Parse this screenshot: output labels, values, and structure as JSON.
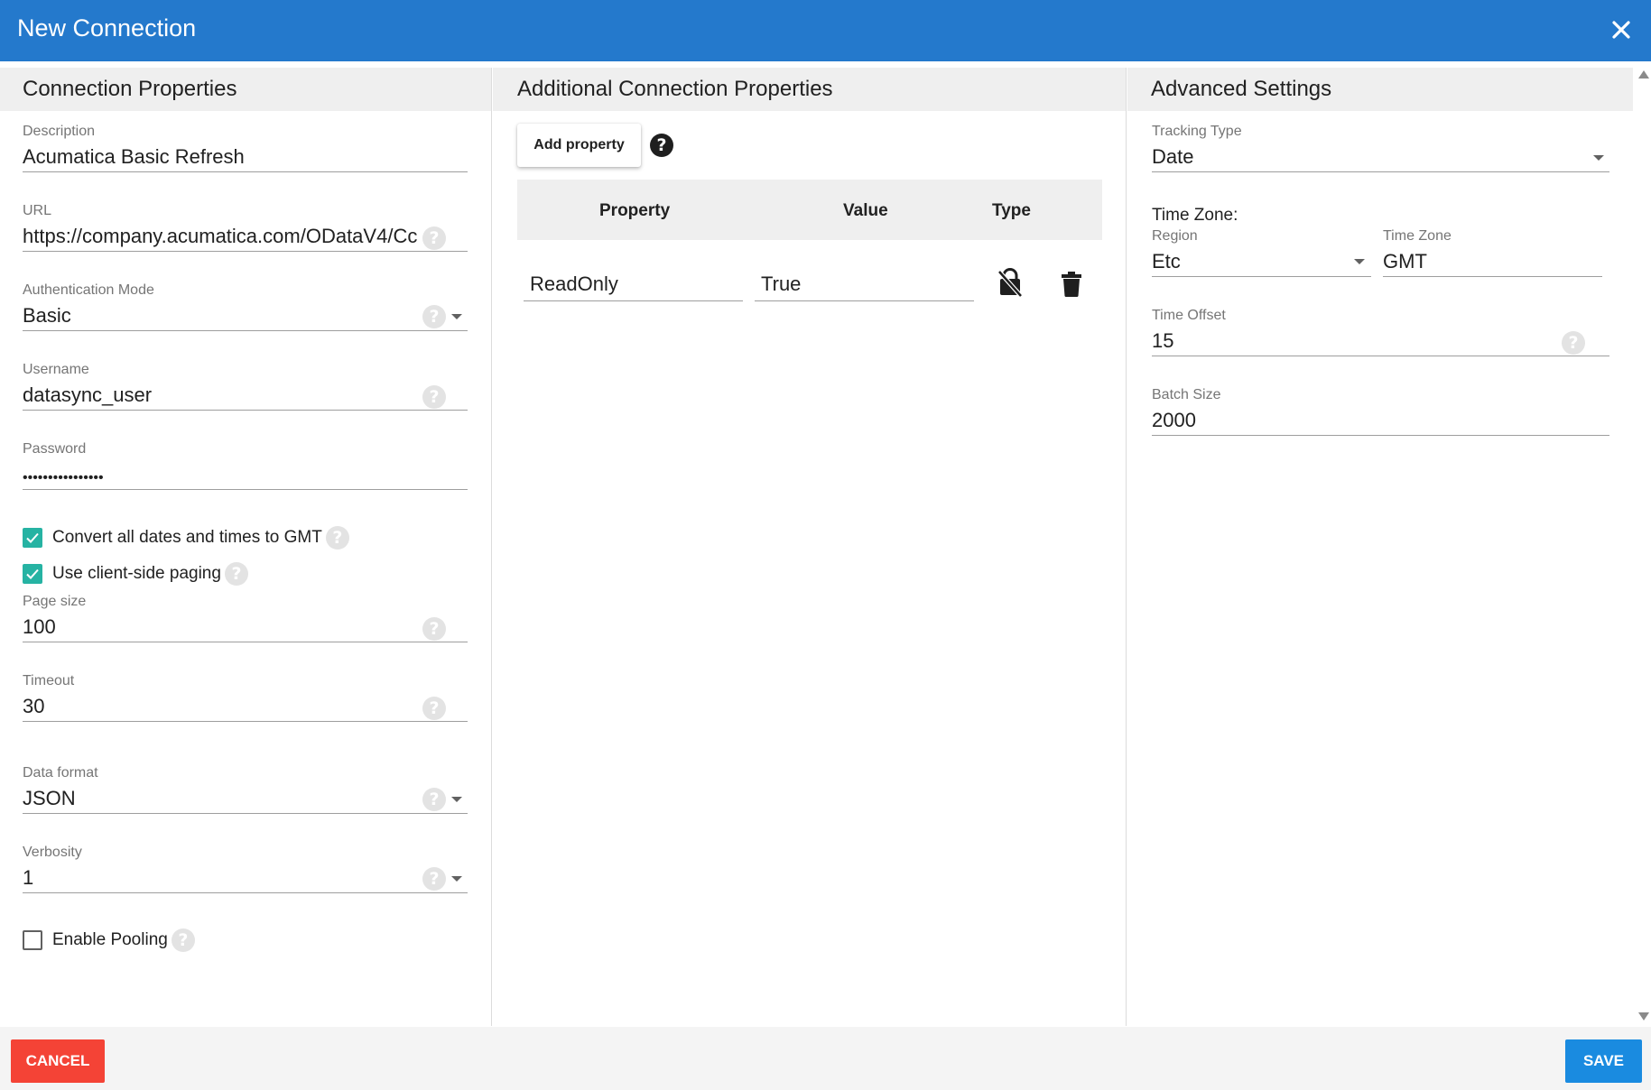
{
  "dialog": {
    "title": "New Connection",
    "close_icon": "close-icon"
  },
  "colors": {
    "title_bar": "#2479cc",
    "checkbox_checked": "#26b3a3",
    "cancel": "#f44336",
    "save": "#1a8be0",
    "panel_header": "#efefef"
  },
  "connection_properties": {
    "header": "Connection Properties",
    "description": {
      "label": "Description",
      "value": "Acumatica Basic Refresh"
    },
    "url": {
      "label": "URL",
      "value": "https://company.acumatica.com/ODataV4/Cc"
    },
    "auth_mode": {
      "label": "Authentication Mode",
      "value": "Basic"
    },
    "username": {
      "label": "Username",
      "value": "datasync_user"
    },
    "password": {
      "label": "Password",
      "value": "••••••••••••••••"
    },
    "convert_dates": {
      "label": "Convert all dates and times to GMT",
      "checked": true
    },
    "client_paging": {
      "label": "Use client-side paging",
      "checked": true
    },
    "page_size": {
      "label": "Page size",
      "value": "100"
    },
    "timeout": {
      "label": "Timeout",
      "value": "30"
    },
    "data_format": {
      "label": "Data format",
      "value": "JSON"
    },
    "verbosity": {
      "label": "Verbosity",
      "value": "1"
    },
    "enable_pooling": {
      "label": "Enable Pooling",
      "checked": false
    }
  },
  "additional_properties": {
    "header": "Additional Connection Properties",
    "add_button": "Add property",
    "columns": {
      "property": "Property",
      "value": "Value",
      "type": "Type"
    },
    "rows": [
      {
        "property": "ReadOnly",
        "value": "True",
        "type_icon": "lock-off-icon",
        "delete_icon": "trash-icon"
      }
    ]
  },
  "advanced_settings": {
    "header": "Advanced Settings",
    "tracking_type": {
      "label": "Tracking Type",
      "value": "Date"
    },
    "time_zone_heading": "Time Zone:",
    "region": {
      "label": "Region",
      "value": "Etc"
    },
    "time_zone": {
      "label": "Time Zone",
      "value": "GMT"
    },
    "time_offset": {
      "label": "Time Offset",
      "value": "15"
    },
    "batch_size": {
      "label": "Batch Size",
      "value": "2000"
    }
  },
  "footer": {
    "cancel": "CANCEL",
    "save": "SAVE"
  }
}
